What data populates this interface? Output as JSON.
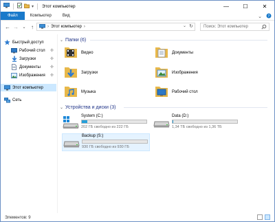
{
  "window": {
    "title": "Этот компьютер"
  },
  "window_controls": {
    "minimize": "—",
    "maximize": "☐",
    "close": "✕"
  },
  "ribbon": {
    "tabs": [
      "Файл",
      "Компьютер",
      "Вид"
    ],
    "expand_icon": "chevron-down-icon",
    "help_icon": "help-icon"
  },
  "address": {
    "back": "←",
    "forward": "→",
    "recent": "⌄",
    "up": "↑",
    "sep": "›",
    "path": "Этот компьютер",
    "tail": "›",
    "dropdown": "⌄",
    "refresh": "↻",
    "search_placeholder": "Поиск: Этот компьютер"
  },
  "sidebar": {
    "quick_access": "Быстрый доступ",
    "items": [
      {
        "label": "Рабочий стол",
        "pinned": true
      },
      {
        "label": "Загрузки",
        "pinned": true
      },
      {
        "label": "Документы",
        "pinned": true
      },
      {
        "label": "Изображения",
        "pinned": true
      }
    ],
    "pin_glyph": "✢",
    "this_pc": "Этот компьютер",
    "network": "Сеть"
  },
  "folders": {
    "header": "Папки (6)",
    "chevron": "⌄",
    "items": [
      {
        "label": "Видео",
        "icon": "video-folder-icon"
      },
      {
        "label": "Документы",
        "icon": "documents-folder-icon"
      },
      {
        "label": "Загрузки",
        "icon": "downloads-folder-icon"
      },
      {
        "label": "Изображения",
        "icon": "pictures-folder-icon"
      },
      {
        "label": "Музыка",
        "icon": "music-folder-icon"
      },
      {
        "label": "Рабочий стол",
        "icon": "desktop-folder-icon"
      }
    ]
  },
  "drives": {
    "header": "Устройства и диски (3)",
    "chevron": "⌄",
    "items": [
      {
        "name": "System (C:)",
        "info": "202 ГБ свободно из 222 ГБ",
        "used_fraction": 0.09,
        "icon": "windows-drive-icon"
      },
      {
        "name": "Data (D:)",
        "info": "1,34 ТБ свободно из 1,36 ТБ",
        "used_fraction": 0.015,
        "icon": "drive-icon"
      },
      {
        "name": "Backup (S:)",
        "info": "930 ГБ свободно из 930 ГБ",
        "used_fraction": 0.0,
        "icon": "drive-icon"
      }
    ]
  },
  "status": {
    "count": "Элементов: 9"
  },
  "colors": {
    "accent": "#1979ca",
    "folder": "#e8b84a",
    "selection": "#cce8ff",
    "bar_fill": "#26a0da"
  }
}
